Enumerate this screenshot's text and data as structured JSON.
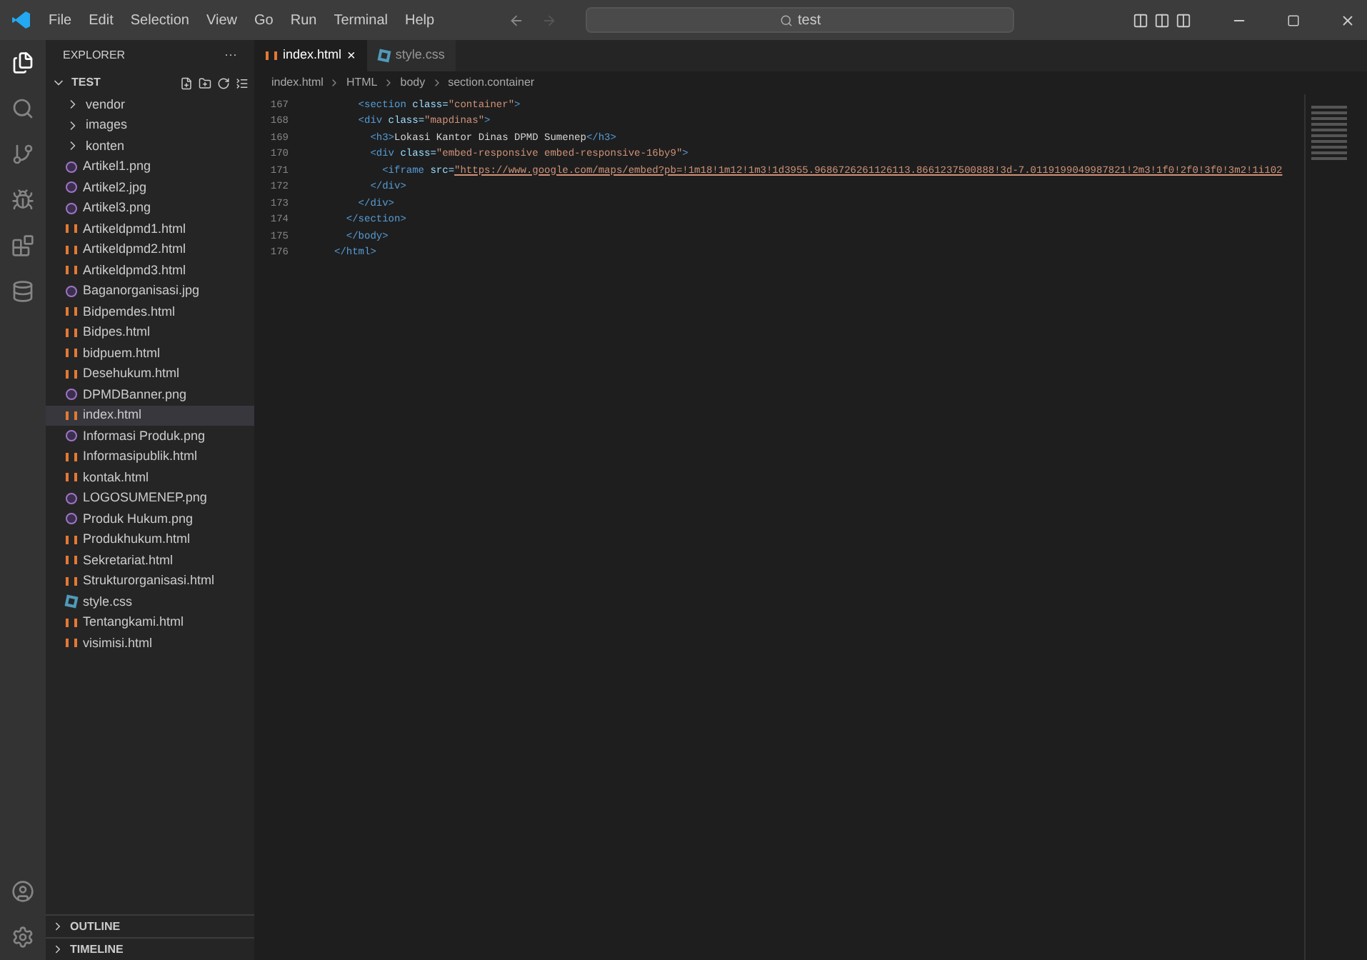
{
  "menu": [
    "File",
    "Edit",
    "Selection",
    "View",
    "Go",
    "Run",
    "Terminal",
    "Help"
  ],
  "search": {
    "value": "test"
  },
  "sidebar": {
    "title": "EXPLORER",
    "more": "···",
    "folder": "TEST",
    "expanded": true,
    "items": [
      {
        "kind": "folder",
        "name": "vendor",
        "selected": false
      },
      {
        "kind": "folder",
        "name": "images",
        "selected": false
      },
      {
        "kind": "folder",
        "name": "konten",
        "selected": false
      },
      {
        "kind": "image",
        "name": "Artikel1.png",
        "selected": false
      },
      {
        "kind": "image",
        "name": "Artikel2.jpg",
        "selected": false
      },
      {
        "kind": "image",
        "name": "Artikel3.png",
        "selected": false
      },
      {
        "kind": "html",
        "name": "Artikeldpmd1.html",
        "selected": false
      },
      {
        "kind": "html",
        "name": "Artikeldpmd2.html",
        "selected": false
      },
      {
        "kind": "html",
        "name": "Artikeldpmd3.html",
        "selected": false
      },
      {
        "kind": "image",
        "name": "Baganorganisasi.jpg",
        "selected": false
      },
      {
        "kind": "html",
        "name": "Bidpemdes.html",
        "selected": false
      },
      {
        "kind": "html",
        "name": "Bidpes.html",
        "selected": false
      },
      {
        "kind": "html",
        "name": "bidpuem.html",
        "selected": false
      },
      {
        "kind": "html",
        "name": "Desehukum.html",
        "selected": false
      },
      {
        "kind": "image",
        "name": "DPMDBanner.png",
        "selected": false
      },
      {
        "kind": "html",
        "name": "index.html",
        "selected": true
      },
      {
        "kind": "image",
        "name": "Informasi Produk.png",
        "selected": false
      },
      {
        "kind": "html",
        "name": "Informasipublik.html",
        "selected": false
      },
      {
        "kind": "html",
        "name": "kontak.html",
        "selected": false
      },
      {
        "kind": "image",
        "name": "LOGOSUMENEP.png",
        "selected": false
      },
      {
        "kind": "image",
        "name": "Produk Hukum.png",
        "selected": false
      },
      {
        "kind": "html",
        "name": "Produkhukum.html",
        "selected": false
      },
      {
        "kind": "html",
        "name": "Sekretariat.html",
        "selected": false
      },
      {
        "kind": "html",
        "name": "Strukturorganisasi.html",
        "selected": false
      },
      {
        "kind": "css",
        "name": "style.css",
        "selected": false
      },
      {
        "kind": "html",
        "name": "Tentangkami.html",
        "selected": false
      },
      {
        "kind": "html",
        "name": "visimisi.html",
        "selected": false
      }
    ],
    "panels": [
      "OUTLINE",
      "TIMELINE"
    ]
  },
  "tabs": [
    {
      "kind": "html",
      "label": "index.html",
      "close": "×",
      "selected": true
    },
    {
      "kind": "css",
      "label": "style.css",
      "selected": false
    }
  ],
  "breadcrumb": [
    "index.html",
    "HTML",
    "body",
    "section.container"
  ],
  "code": [
    {
      "line": "167",
      "tokens": [
        {
          "kind": "tag",
          "text": "    <section"
        },
        {
          "kind": "attr",
          "text": " class="
        },
        {
          "kind": "string",
          "text": "\"container\""
        },
        {
          "kind": "tag",
          "text": ">"
        }
      ]
    },
    {
      "line": "168",
      "tokens": [
        {
          "kind": "tag",
          "text": "    <div"
        },
        {
          "kind": "attr",
          "text": " class="
        },
        {
          "kind": "string",
          "text": "\"mapdinas\""
        },
        {
          "kind": "tag",
          "text": ">"
        }
      ]
    },
    {
      "line": "169",
      "tokens": [
        {
          "kind": "tag",
          "text": "      <h3>"
        },
        {
          "kind": "text",
          "text": "Lokasi Kantor Dinas DPMD Sumenep"
        },
        {
          "kind": "tag",
          "text": "</h3>"
        }
      ]
    },
    {
      "line": "170",
      "tokens": [
        {
          "kind": "tag",
          "text": "      <div"
        },
        {
          "kind": "attr",
          "text": " class="
        },
        {
          "kind": "string",
          "text": "\"embed-responsive embed-responsive-16by9\""
        },
        {
          "kind": "tag",
          "text": ">"
        }
      ]
    },
    {
      "line": "171",
      "tokens": [
        {
          "kind": "tag",
          "text": "        <iframe"
        },
        {
          "kind": "attr",
          "text": " src="
        },
        {
          "kind": "link",
          "text": "\"https://www.google.com/maps/embed?pb=!1m18!1m12!1m3!1d3955.9686726261126113.8661237500888!3d-7.0119199049987821!2m3!1f0!2f0!3f0!3m2!1i102"
        }
      ]
    },
    {
      "line": "172",
      "tokens": [
        {
          "kind": "tag",
          "text": "      </div>"
        }
      ]
    },
    {
      "line": "173",
      "tokens": [
        {
          "kind": "tag",
          "text": "    </div>"
        }
      ]
    },
    {
      "line": "174",
      "tokens": [
        {
          "kind": "tag",
          "text": "  </section>"
        }
      ]
    },
    {
      "line": "175",
      "tokens": [
        {
          "kind": "tag",
          "text": "  </body>"
        }
      ]
    },
    {
      "line": "176",
      "tokens": [
        {
          "kind": "tag",
          "text": "</html>"
        }
      ]
    }
  ]
}
